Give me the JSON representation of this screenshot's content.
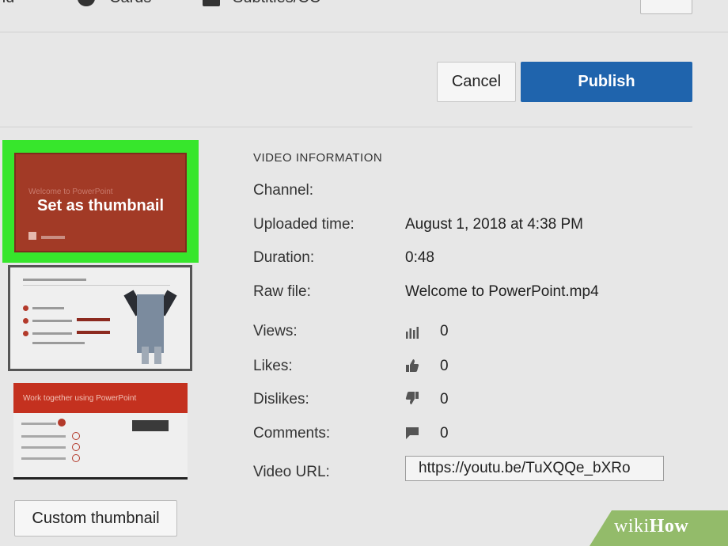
{
  "top_tabs": {
    "tab1": "nd",
    "tab2": "Cards",
    "tab3": "Subtitles/CC"
  },
  "actions": {
    "cancel_label": "Cancel",
    "publish_label": "Publish"
  },
  "thumbnails": {
    "selected_overlay": "Set as thumbnail",
    "thumb1_faint_text": "Welcome to PowerPoint",
    "thumb3_banner_text": "Work together using PowerPoint",
    "custom_button_label": "Custom thumbnail"
  },
  "video_info": {
    "section_title": "VIDEO INFORMATION",
    "channel_label": "Channel:",
    "uploaded_label": "Uploaded time:",
    "uploaded_value": "August 1, 2018 at 4:38 PM",
    "duration_label": "Duration:",
    "duration_value": "0:48",
    "rawfile_label": "Raw file:",
    "rawfile_value": "Welcome to PowerPoint.mp4",
    "views_label": "Views:",
    "views_value": "0",
    "likes_label": "Likes:",
    "likes_value": "0",
    "dislikes_label": "Dislikes:",
    "dislikes_value": "0",
    "comments_label": "Comments:",
    "comments_value": "0",
    "url_label": "Video URL:",
    "url_value": "https://youtu.be/TuXQQe_bXRo"
  },
  "icons": {
    "views": "bar-chart-icon",
    "likes": "thumbs-up-icon",
    "dislikes": "thumbs-down-icon",
    "comments": "comment-icon"
  },
  "colors": {
    "accent": "#1f64ad",
    "highlight": "#37e62c",
    "slide_red": "#a23a26",
    "watermark": "#93bb6a"
  },
  "watermark": "wikiHow"
}
